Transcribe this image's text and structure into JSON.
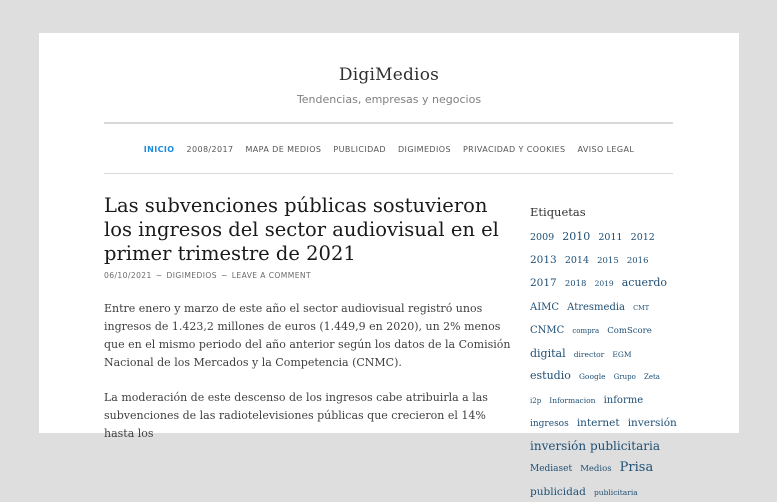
{
  "site": {
    "title": "DigiMedios",
    "tagline": "Tendencias, empresas y negocios"
  },
  "menu": [
    {
      "label": "Inicio",
      "active": true
    },
    {
      "label": "2008/2017",
      "active": false
    },
    {
      "label": "Mapa de medios",
      "active": false
    },
    {
      "label": "Publicidad",
      "active": false
    },
    {
      "label": "Digimedios",
      "active": false
    },
    {
      "label": "Privacidad y cookies",
      "active": false
    },
    {
      "label": "Aviso legal",
      "active": false
    }
  ],
  "post": {
    "title": "Las subvenciones públicas sostuvieron los ingresos del sector audiovisual en el primer trimestre de 2021",
    "date": "06/10/2021",
    "author": "digimedios",
    "comments": "Leave a comment",
    "separator": "~",
    "paragraphs": [
      "Entre enero y marzo de este año el sector audiovisual registró unos ingresos de 1.423,2 millones de euros (1.449,9 en 2020), un 2% menos que en el mismo periodo del año anterior según los datos de la Comisión Nacional de los Mercados y la Competencia (CNMC).",
      "La moderación de este descenso de los ingresos cabe atribuirla a las subvenciones de las radiotelevisiones públicas que crecieron el 14% hasta los"
    ]
  },
  "sidebar": {
    "widget_title": "Etiquetas",
    "tags": [
      {
        "label": "2009",
        "size": 9.5
      },
      {
        "label": "2010",
        "size": 11
      },
      {
        "label": "2011",
        "size": 9.5
      },
      {
        "label": "2012",
        "size": 9.5
      },
      {
        "label": "2013",
        "size": 10.5
      },
      {
        "label": "2014",
        "size": 9.5
      },
      {
        "label": "2015",
        "size": 8.5
      },
      {
        "label": "2016",
        "size": 8.5
      },
      {
        "label": "2017",
        "size": 10.5
      },
      {
        "label": "2018",
        "size": 8.5
      },
      {
        "label": "2019",
        "size": 7.5
      },
      {
        "label": "acuerdo",
        "size": 11
      },
      {
        "label": "AIMC",
        "size": 10
      },
      {
        "label": "Atresmedia",
        "size": 10
      },
      {
        "label": "CMT",
        "size": 6.5
      },
      {
        "label": "CNMC",
        "size": 10
      },
      {
        "label": "compra",
        "size": 7
      },
      {
        "label": "ComScore",
        "size": 8.5
      },
      {
        "label": "digital",
        "size": 11
      },
      {
        "label": "director",
        "size": 7.5
      },
      {
        "label": "EGM",
        "size": 7.5
      },
      {
        "label": "estudio",
        "size": 11
      },
      {
        "label": "Google",
        "size": 7.5
      },
      {
        "label": "Grupo",
        "size": 7
      },
      {
        "label": "Zeta",
        "size": 7
      },
      {
        "label": "i2p",
        "size": 7
      },
      {
        "label": "Informacion",
        "size": 7.5
      },
      {
        "label": "informe",
        "size": 10
      },
      {
        "label": "ingresos",
        "size": 9
      },
      {
        "label": "internet",
        "size": 10.5
      },
      {
        "label": "inversión",
        "size": 10.5
      },
      {
        "label": "inversión publicitaria",
        "size": 12
      },
      {
        "label": "Mediaset",
        "size": 9
      },
      {
        "label": "Medios",
        "size": 8.5
      },
      {
        "label": "Prisa",
        "size": 13
      },
      {
        "label": "publicidad",
        "size": 10.5
      },
      {
        "label": "publicitaria",
        "size": 7.5
      }
    ]
  }
}
